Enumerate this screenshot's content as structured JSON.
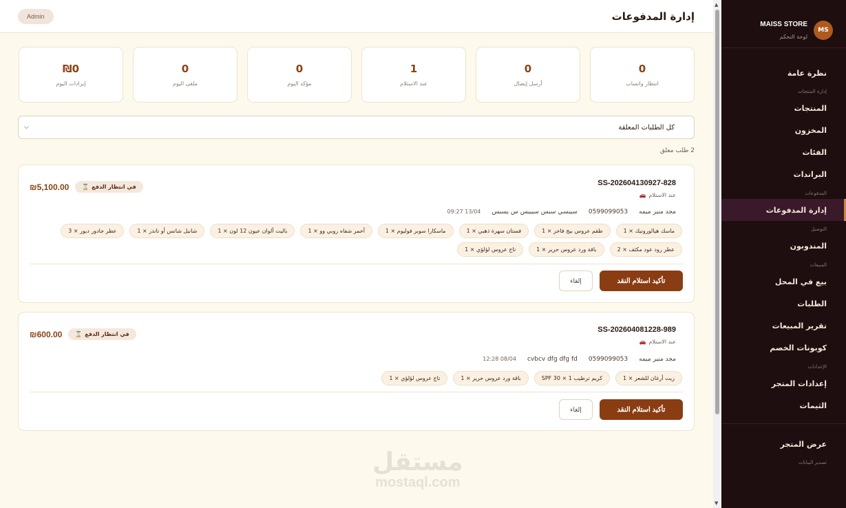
{
  "header": {
    "title": "إدارة المدفوعات",
    "admin_label": "Admin"
  },
  "stats": [
    {
      "value": "0",
      "label": "انتظار واتساب"
    },
    {
      "value": "0",
      "label": "أرسل إيصال"
    },
    {
      "value": "1",
      "label": "عند الاستلام"
    },
    {
      "value": "0",
      "label": "مؤكد اليوم"
    },
    {
      "value": "0",
      "label": "ملغى اليوم"
    },
    {
      "value": "₪0",
      "label": "إيرادات اليوم"
    }
  ],
  "filter": {
    "selected": "كل الطلبات المعلقة"
  },
  "pending_count": "2 طلب معلق",
  "orders": [
    {
      "id": "SS-202604130927-828",
      "delivery": "عند الاستلام",
      "total": "₪5,100.00",
      "status": "في انتظار الدفع",
      "customer": "مجد منير ميمه",
      "phone": "0599099053",
      "address": "سيبسي سبس سيبيس س يسبس",
      "time": "13/04 09:27",
      "items": [
        "ماسك هيالورونيك × 1",
        "طقم عروس بيج فاخر × 1",
        "فستان سهرة ذهبي × 1",
        "ماسكارا سوبر فوليوم × 1",
        "أحمر شفاه روبي وو × 1",
        "باليت ألوان عيون 12 لون × 1",
        "شانيل شانس أو تاندر × 1",
        "عطر جادور ديور × 3",
        "عطر رود عود مكثف × 2",
        "باقة ورد عروس حرير × 1",
        "تاج عروس لؤلؤي × 1"
      ],
      "confirm_label": "تأكيد استلام النقد",
      "cancel_label": "إلغاء"
    },
    {
      "id": "SS-202604081228-989",
      "delivery": "عند الاستلام",
      "total": "₪600.00",
      "status": "في انتظار الدفع",
      "customer": "مجد منير ميمه",
      "phone": "0599099053",
      "address": "cvbcv dfg dfg fd",
      "time": "08/04 12:28",
      "items": [
        "زيت أرغان للشعر × 1",
        "كريم ترطيب SPF 30 × 1",
        "باقة ورد عروس حرير × 1",
        "تاج عروس لؤلؤي × 1"
      ],
      "confirm_label": "تأكيد استلام النقد",
      "cancel_label": "إلغاء"
    }
  ],
  "sidebar": {
    "avatar": "MS",
    "store_name": "MAISS STORE",
    "subtitle": "لوحة التحكم",
    "overview": "نظرة عامة",
    "sec_products": "إدارة المنتجات",
    "products": "المنتجات",
    "inventory": "المخزون",
    "categories": "الفئات",
    "brands": "البراندات",
    "sec_payments": "المدفوعات",
    "payments": "إدارة المدفوعات",
    "sec_delivery": "التوصيل",
    "couriers": "المندوبون",
    "sec_sales": "المبيعات",
    "pos": "بيع في المحل",
    "orders": "الطلبات",
    "sales_report": "تقرير المبيعات",
    "coupons": "كوبونات الخصم",
    "sec_settings": "الإعدادات",
    "store_settings": "إعدادات المتجر",
    "themes": "الثيمات",
    "view_store": "عرض المتجر",
    "export_data": "تصدير البيانات"
  },
  "watermark": {
    "ar": "مستقل",
    "en": "mostaql.com"
  },
  "colors": {
    "sidebar_bg": "#1e0e10",
    "accent": "#8a3d12",
    "page_bg": "#fdf9ec",
    "avatar_bg": "#b0591e"
  }
}
